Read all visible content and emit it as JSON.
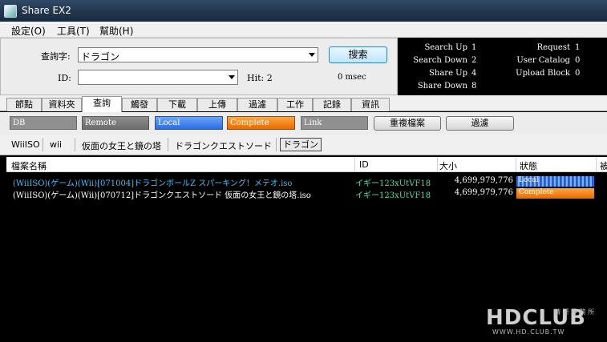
{
  "window": {
    "title": "Share EX2"
  },
  "menu": [
    "設定(O)",
    "工具(T)",
    "幫助(H)"
  ],
  "search": {
    "keyword_label": "查詢字:",
    "keyword_value": "ドラゴン",
    "id_label": "ID:",
    "id_value": "",
    "hit_text": "Hit: 2",
    "time_text": "0 msec",
    "search_button": "搜索"
  },
  "stats": {
    "search_up_label": "Search Up",
    "search_up_value": "1",
    "search_down_label": "Search Down",
    "search_down_value": "2",
    "share_up_label": "Share Up",
    "share_up_value": "4",
    "share_down_label": "Share Down",
    "share_down_value": "8",
    "request_label": "Request",
    "request_value": "1",
    "user_catalog_label": "User Catalog",
    "user_catalog_value": "0",
    "upload_block_label": "Upload Block",
    "upload_block_value": "0"
  },
  "tabs": [
    "節點",
    "資料夾",
    "查詢",
    "觸發",
    "下載",
    "上傳",
    "過濾",
    "工作",
    "記錄",
    "資訊"
  ],
  "filters": {
    "db": "DB",
    "remote": "Remote",
    "local": "Local",
    "complete": "Complete",
    "link": "Link",
    "dup_button": "重複檔案",
    "filter_button": "過濾"
  },
  "keywords": [
    "WiiISO",
    "wii",
    "仮面の女王と鏡の塔",
    "ドラゴンクエストソード",
    "ドラゴン"
  ],
  "columns": {
    "name": "檔案名稱",
    "id": "ID",
    "size": "大小",
    "status": "狀態",
    "extra": "被"
  },
  "rows": [
    {
      "name": "(WiiISO)(ゲーム)(Wii)[071004]ドラゴンボールZ スパーキング！メテオ.iso",
      "id": "イギー123xUtVF18",
      "size": "4,699,979,776",
      "status": "Local"
    },
    {
      "name": "(WiiISO)(ゲーム)(Wii)[070712]ドラゴンクエストソード 仮面の女王と鏡の塔.iso",
      "id": "イギー123xUtVF18",
      "size": "4,699,979,776",
      "status": "Complete"
    }
  ],
  "watermark": {
    "logo": "HDCLUB",
    "sub": "精 研 專 務 所",
    "url": "WWW.HD.CLUB.TW"
  },
  "colors": {
    "local": "#2d6cde",
    "complete": "#e86a00",
    "row1_text": "#33c6ff",
    "row2_text": "#ffffff",
    "id_text": "#3ee0b0"
  }
}
